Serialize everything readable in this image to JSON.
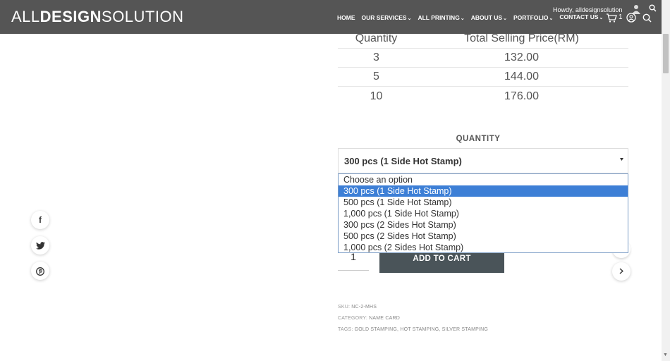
{
  "header": {
    "logo_light": "ALL",
    "logo_bold": "DESIGN",
    "logo_light2": "SOLUTION",
    "nav": [
      {
        "label": "HOME",
        "has_chevron": false
      },
      {
        "label": "OUR SERVICES",
        "has_chevron": true
      },
      {
        "label": "ALL PRINTING",
        "has_chevron": true
      },
      {
        "label": "ABOUT US",
        "has_chevron": true
      },
      {
        "label": "PORTFOLIO",
        "has_chevron": true
      },
      {
        "label": "CONTACT US",
        "has_chevron": true
      }
    ],
    "chevron": "⌄",
    "greeting": "Howdy, alldesignsolution",
    "cart_count": "1",
    "background": "#555555"
  },
  "price_table": {
    "headers": [
      "Quantity",
      "Total Selling Price(RM)"
    ],
    "rows": [
      [
        "3",
        "132.00"
      ],
      [
        "5",
        "144.00"
      ],
      [
        "10",
        "176.00"
      ]
    ]
  },
  "quantity": {
    "label": "QUANTITY",
    "selected": "300 pcs (1 Side Hot Stamp)",
    "options": [
      "Choose an option",
      "300 pcs (1 Side Hot Stamp)",
      "500 pcs (1 Side Hot Stamp)",
      "1,000 pcs (1 Side Hot Stamp)",
      "300 pcs (2 Sides Hot Stamp)",
      "500 pcs (2 Sides Hot Stamp)",
      "1,000 pcs (2 Sides Hot Stamp)"
    ],
    "selected_index": 1,
    "highlight_color": "#3d7fd6"
  },
  "cart": {
    "qty_value": "1",
    "add_label": "ADD TO CART",
    "button_color": "#4a5459"
  },
  "social": [
    "facebook-icon",
    "twitter-icon",
    "pinterest-icon"
  ],
  "meta": {
    "sku_label": "SKU:",
    "sku": "NC-2-MHS",
    "category_label": "CATEGORY:",
    "category": "NAME CARD",
    "tags_label": "TAGS:",
    "tags": "GOLD STAMPING, HOT STAMPING, SILVER STAMPING"
  }
}
